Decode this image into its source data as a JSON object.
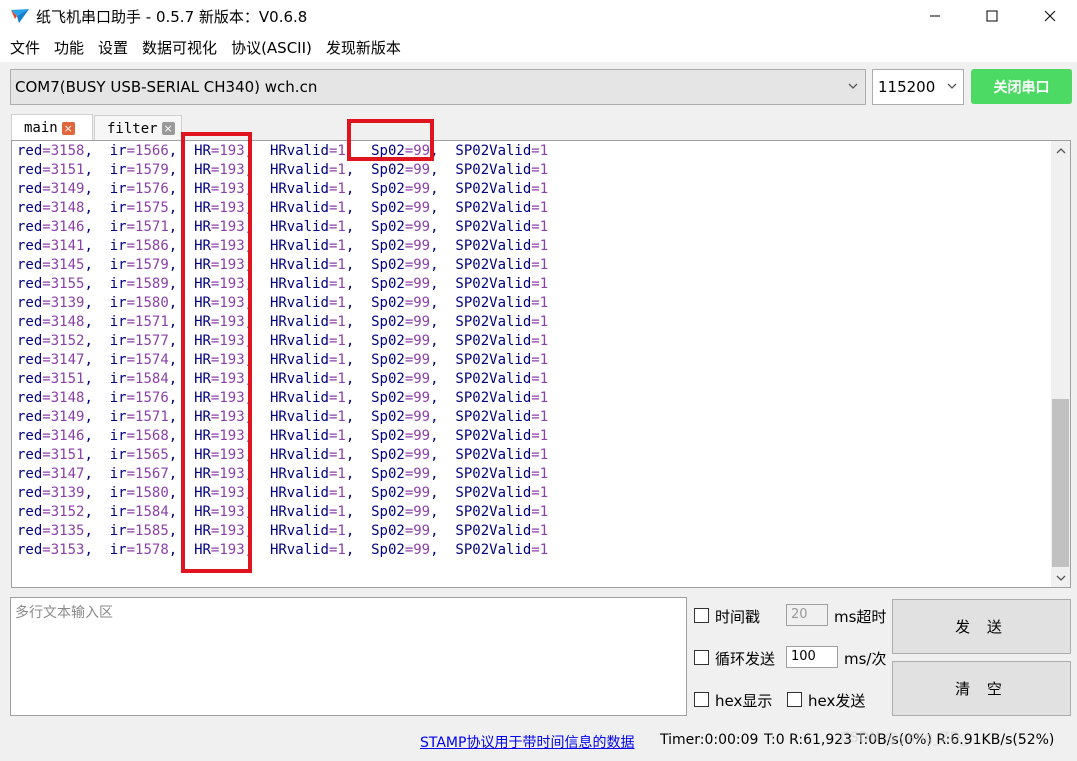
{
  "window": {
    "title": "纸飞机串口助手 - 0.5.7 新版本：V0.6.8",
    "icon": "paper-plane-icon"
  },
  "menu": [
    "文件",
    "功能",
    "设置",
    "数据可视化",
    "协议(ASCII)",
    "发现新版本"
  ],
  "toolbar": {
    "port": "COM7(BUSY  USB-SERIAL CH340) wch.cn",
    "baud": "115200",
    "close_port_label": "关闭串口",
    "close_port_color": "#4cd964"
  },
  "tabs": [
    {
      "label": "main",
      "active": true
    },
    {
      "label": "filter",
      "active": false
    }
  ],
  "output_lines": [
    {
      "red": "3158",
      "ir": "1566",
      "HR": "193",
      "HRvalid": "1",
      "Sp02": "99",
      "SP02Valid": "1"
    },
    {
      "red": "3151",
      "ir": "1579",
      "HR": "193",
      "HRvalid": "1",
      "Sp02": "99",
      "SP02Valid": "1"
    },
    {
      "red": "3149",
      "ir": "1576",
      "HR": "193",
      "HRvalid": "1",
      "Sp02": "99",
      "SP02Valid": "1"
    },
    {
      "red": "3148",
      "ir": "1575",
      "HR": "193",
      "HRvalid": "1",
      "Sp02": "99",
      "SP02Valid": "1"
    },
    {
      "red": "3146",
      "ir": "1571",
      "HR": "193",
      "HRvalid": "1",
      "Sp02": "99",
      "SP02Valid": "1"
    },
    {
      "red": "3141",
      "ir": "1586",
      "HR": "193",
      "HRvalid": "1",
      "Sp02": "99",
      "SP02Valid": "1"
    },
    {
      "red": "3145",
      "ir": "1579",
      "HR": "193",
      "HRvalid": "1",
      "Sp02": "99",
      "SP02Valid": "1"
    },
    {
      "red": "3155",
      "ir": "1589",
      "HR": "193",
      "HRvalid": "1",
      "Sp02": "99",
      "SP02Valid": "1"
    },
    {
      "red": "3139",
      "ir": "1580",
      "HR": "193",
      "HRvalid": "1",
      "Sp02": "99",
      "SP02Valid": "1"
    },
    {
      "red": "3148",
      "ir": "1571",
      "HR": "193",
      "HRvalid": "1",
      "Sp02": "99",
      "SP02Valid": "1"
    },
    {
      "red": "3152",
      "ir": "1577",
      "HR": "193",
      "HRvalid": "1",
      "Sp02": "99",
      "SP02Valid": "1"
    },
    {
      "red": "3147",
      "ir": "1574",
      "HR": "193",
      "HRvalid": "1",
      "Sp02": "99",
      "SP02Valid": "1"
    },
    {
      "red": "3151",
      "ir": "1584",
      "HR": "193",
      "HRvalid": "1",
      "Sp02": "99",
      "SP02Valid": "1"
    },
    {
      "red": "3148",
      "ir": "1576",
      "HR": "193",
      "HRvalid": "1",
      "Sp02": "99",
      "SP02Valid": "1"
    },
    {
      "red": "3149",
      "ir": "1571",
      "HR": "193",
      "HRvalid": "1",
      "Sp02": "99",
      "SP02Valid": "1"
    },
    {
      "red": "3146",
      "ir": "1568",
      "HR": "193",
      "HRvalid": "1",
      "Sp02": "99",
      "SP02Valid": "1"
    },
    {
      "red": "3151",
      "ir": "1565",
      "HR": "193",
      "HRvalid": "1",
      "Sp02": "99",
      "SP02Valid": "1"
    },
    {
      "red": "3147",
      "ir": "1567",
      "HR": "193",
      "HRvalid": "1",
      "Sp02": "99",
      "SP02Valid": "1"
    },
    {
      "red": "3139",
      "ir": "1580",
      "HR": "193",
      "HRvalid": "1",
      "Sp02": "99",
      "SP02Valid": "1"
    },
    {
      "red": "3152",
      "ir": "1584",
      "HR": "193",
      "HRvalid": "1",
      "Sp02": "99",
      "SP02Valid": "1"
    },
    {
      "red": "3135",
      "ir": "1585",
      "HR": "193",
      "HRvalid": "1",
      "Sp02": "99",
      "SP02Valid": "1"
    },
    {
      "red": "3153",
      "ir": "1578",
      "HR": "193",
      "HRvalid": "1",
      "Sp02": "99",
      "SP02Valid": "1"
    }
  ],
  "highlight_color": "#e0141e",
  "send_panel": {
    "placeholder": "多行文本输入区",
    "timestamp_label": "时间戳",
    "timeout_value": "20",
    "timeout_unit": "ms超时",
    "loop_label": "循环发送",
    "loop_value": "100",
    "loop_unit": "ms/次",
    "hex_display_label": "hex显示",
    "hex_send_label": "hex发送",
    "send_label": "发 送",
    "clear_label": "清 空"
  },
  "status": {
    "stamp_link": "STAMP协议用于带时间信息的数据",
    "timer": "Timer:0:00:09",
    "counts": "T:0 R:61,923 T:0B/s(0%) R:6.91KB/s(52%)",
    "watermark": "CSDN @yang_ZD_"
  }
}
